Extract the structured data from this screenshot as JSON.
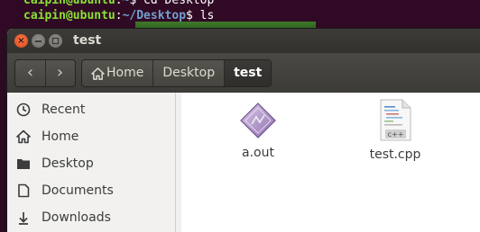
{
  "terminal": {
    "line1_user": "caipin@ubuntu",
    "line1_sep": ":",
    "line1_path": "~",
    "line1_cmd": "$ cd Desktop",
    "line2_user": "caipin@ubuntu",
    "line2_sep": ":",
    "line2_path": "~/Desktop",
    "line2_cmd": "$ ls"
  },
  "window": {
    "title": "test",
    "close_glyph": "×"
  },
  "toolbar": {
    "back_glyph": "‹",
    "forward_glyph": "›",
    "breadcrumbs": [
      {
        "label": "Home",
        "icon": "home-icon"
      },
      {
        "label": "Desktop"
      },
      {
        "label": "test"
      }
    ]
  },
  "sidebar": {
    "items": [
      {
        "label": "Recent",
        "icon": "clock-icon"
      },
      {
        "label": "Home",
        "icon": "home-icon"
      },
      {
        "label": "Desktop",
        "icon": "folder-icon"
      },
      {
        "label": "Documents",
        "icon": "document-icon"
      },
      {
        "label": "Downloads",
        "icon": "download-icon"
      }
    ]
  },
  "files": [
    {
      "name": "a.out",
      "icon": "executable-icon"
    },
    {
      "name": "test.cpp",
      "icon": "cpp-source-icon",
      "badge": "c++"
    }
  ]
}
